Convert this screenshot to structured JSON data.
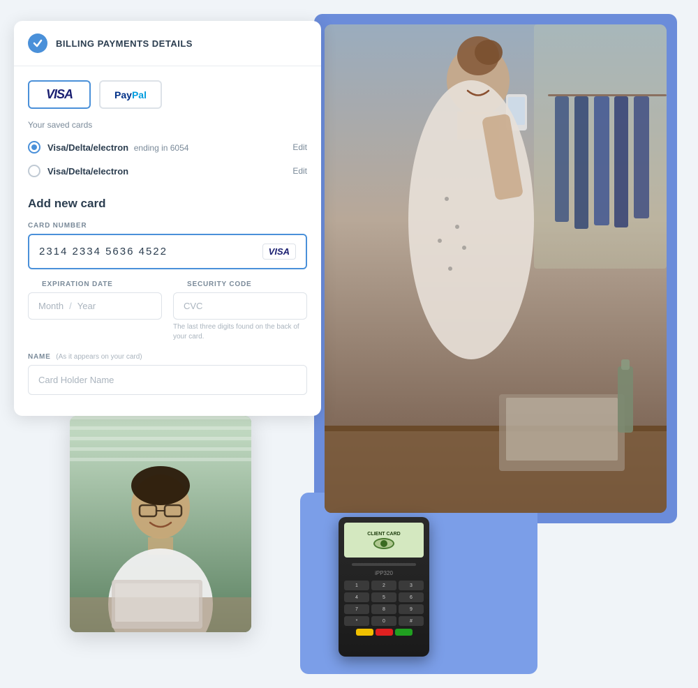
{
  "page": {
    "title": "Billing Payments Details"
  },
  "header": {
    "title": "BILLING PAYMENTS DETAILS"
  },
  "payment_methods": {
    "visa_label": "VISA",
    "paypal_label": "PayPal"
  },
  "saved_cards": {
    "label": "Your saved cards",
    "cards": [
      {
        "name": "Visa/Delta/electron",
        "ending": "ending in 6054",
        "selected": true,
        "edit_label": "Edit"
      },
      {
        "name": "Visa/Delta/electron",
        "ending": "",
        "selected": false,
        "edit_label": "Edit"
      }
    ]
  },
  "add_new_card": {
    "title": "Add new card",
    "card_number_label": "CARD NUMBER",
    "card_number_value": "2314  2334  5636  4522",
    "expiry_label": "EXPIRATION DATE",
    "expiry_month_placeholder": "Month",
    "expiry_slash": "/",
    "expiry_year_placeholder": "Year",
    "security_label": "SECURITY CODE",
    "security_placeholder": "CVC",
    "security_hint": "The last three digits found on the back of your card.",
    "name_label": "NAME",
    "name_inline_label": "(As it appears on your card)",
    "name_placeholder": "Card Holder Name"
  },
  "colors": {
    "accent_blue": "#4a90d9",
    "text_dark": "#2c3e50",
    "text_muted": "#7a8a99",
    "border": "#dde2e8",
    "blue_bg": "#7b9ee8"
  }
}
